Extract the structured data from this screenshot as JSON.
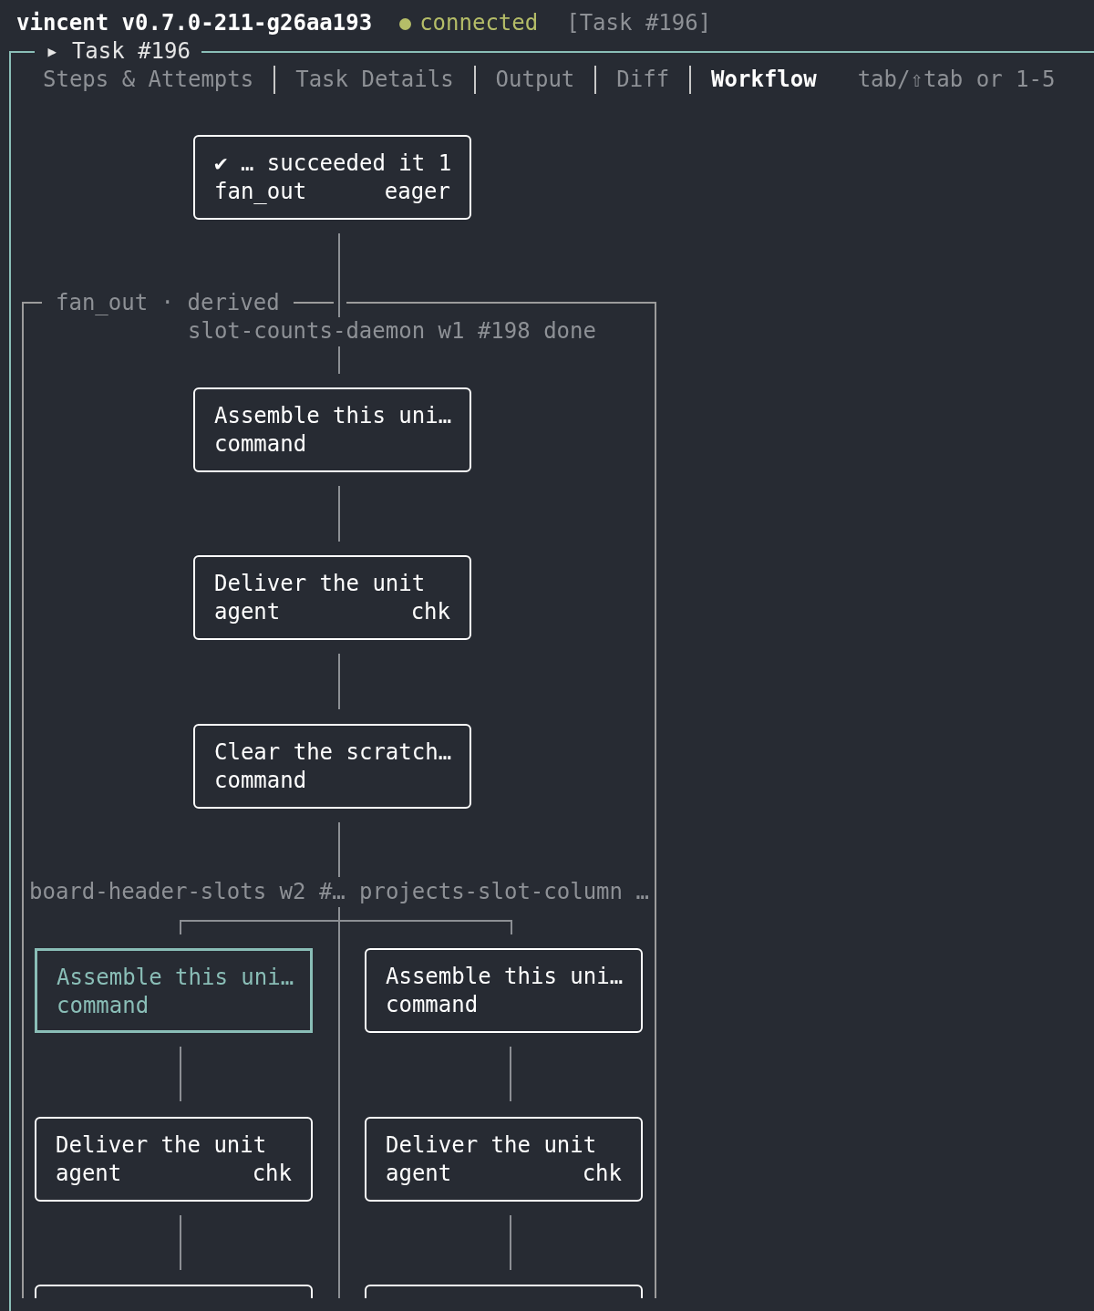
{
  "header": {
    "app": "vincent v0.7.0-211-g26aa193",
    "connected": true,
    "status": "connected",
    "context": "[Task #196]"
  },
  "panel": {
    "title": "▸ Task #196"
  },
  "tabs": [
    {
      "label": "Steps & Attempts",
      "selected": false
    },
    {
      "label": "Task Details",
      "selected": false
    },
    {
      "label": "Output",
      "selected": false
    },
    {
      "label": "Diff",
      "selected": false
    },
    {
      "label": "Workflow",
      "selected": true
    }
  ],
  "tab_hint": "tab/⇧tab or 1-5",
  "workflow": {
    "top_node": {
      "title": "✔ … succeeded it 1",
      "type": "fan_out",
      "tag": "eager"
    },
    "group": {
      "title": "fan_out · derived",
      "subtitle": "slot-counts-daemon w1 #198 done",
      "nodes": [
        {
          "title": "Assemble this uni…",
          "type": "command"
        },
        {
          "title": "Deliver the unit",
          "type": "agent",
          "tag": "chk"
        },
        {
          "title": "Clear the scratch…",
          "type": "command"
        }
      ],
      "branches": [
        {
          "label": "board-header-slots w2 #…",
          "nodes": [
            {
              "kind": "node",
              "title": "Assemble this uni…",
              "type": "command",
              "selected": true
            },
            {
              "kind": "node",
              "title": "Deliver the unit",
              "type": "agent",
              "tag": "chk",
              "selected": false
            },
            {
              "kind": "clipped",
              "selected": false
            }
          ]
        },
        {
          "label": "projects-slot-column …",
          "nodes": [
            {
              "kind": "node",
              "title": "Assemble this uni…",
              "type": "command",
              "selected": false
            },
            {
              "kind": "node",
              "title": "Deliver the unit",
              "type": "agent",
              "tag": "chk",
              "selected": false
            },
            {
              "kind": "clipped",
              "selected": false
            }
          ]
        }
      ]
    }
  }
}
